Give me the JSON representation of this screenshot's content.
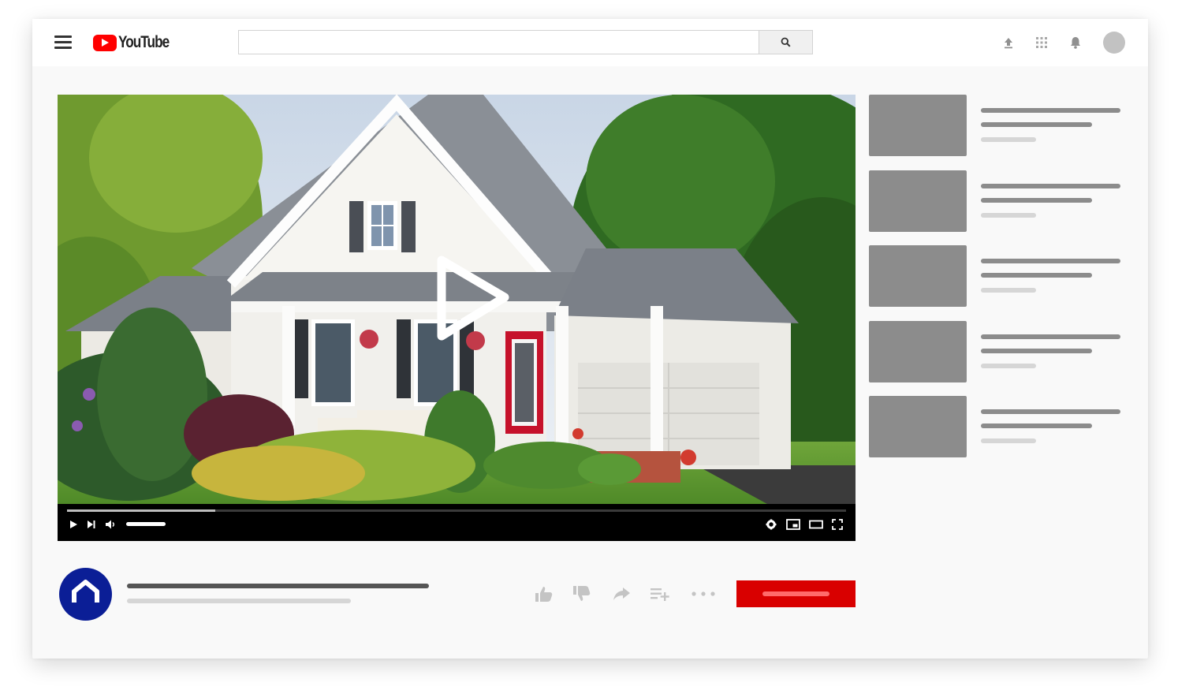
{
  "header": {
    "logo_text": "YouTube",
    "search": {
      "value": "",
      "placeholder": ""
    },
    "icons": [
      "menu-icon",
      "search-icon",
      "upload-icon",
      "apps-grid-icon",
      "bell-icon",
      "avatar"
    ]
  },
  "player": {
    "progress_fraction": 0.19,
    "volume_fraction": 1.0,
    "controls": [
      "play-icon",
      "next-icon",
      "volume-icon",
      "settings-gear-icon",
      "miniplayer-icon",
      "theater-icon",
      "fullscreen-icon"
    ]
  },
  "sidebar": {
    "recommendations": [
      {
        "kind": "placeholder"
      },
      {
        "kind": "placeholder"
      },
      {
        "kind": "placeholder"
      },
      {
        "kind": "placeholder"
      },
      {
        "kind": "placeholder"
      }
    ]
  },
  "video_info": {
    "actions": [
      "like-icon",
      "dislike-icon",
      "share-icon",
      "add-to-playlist-icon",
      "more-icon"
    ]
  },
  "colors": {
    "brand_red": "#ff0000",
    "subscribe_red": "#d90000",
    "channel_blue": "#0b1e96",
    "skeleton_dark": "#8c8c8c",
    "skeleton_light": "#d6d6d6"
  }
}
